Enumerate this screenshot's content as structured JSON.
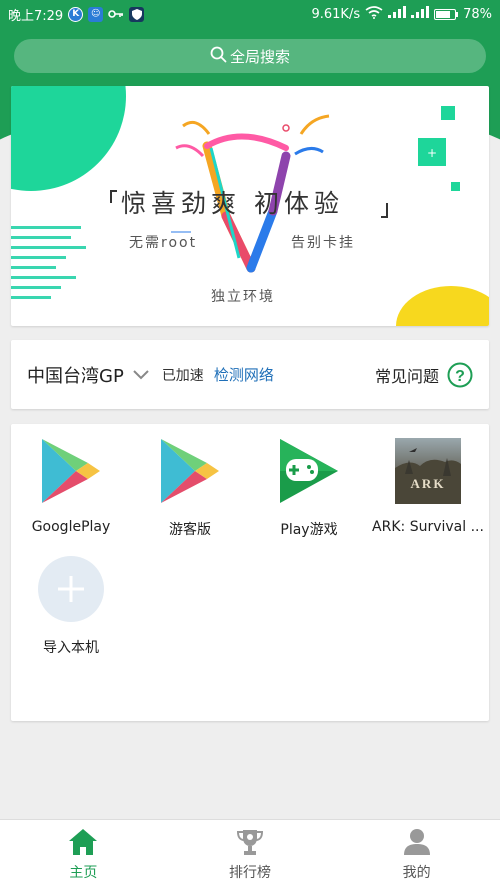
{
  "status_bar": {
    "time": "晚上7:29",
    "speed": "9.61K/s",
    "battery": "78%",
    "battery_level": 0.78
  },
  "search": {
    "label": "全局搜索"
  },
  "banner": {
    "title": "惊喜劲爽  初体验",
    "sub_left": "无需root",
    "sub_right": "告别卡挂",
    "sub_bottom": "独立环境"
  },
  "network": {
    "region": "中国台湾GP",
    "status": "已加速",
    "detect": "检测网络",
    "faq": "常见问题"
  },
  "apps": [
    {
      "label": "GooglePlay",
      "icon": "play-store-icon"
    },
    {
      "label": "游客版",
      "icon": "play-store-icon"
    },
    {
      "label": "Play游戏",
      "icon": "play-games-icon"
    },
    {
      "label": "ARK: Survival ...",
      "icon": "ark-icon"
    }
  ],
  "import": {
    "label": "导入本机"
  },
  "nav": {
    "home": "主页",
    "ranking": "排行榜",
    "mine": "我的"
  },
  "colors": {
    "brand": "#1e9e55",
    "link": "#1f6fb8"
  }
}
